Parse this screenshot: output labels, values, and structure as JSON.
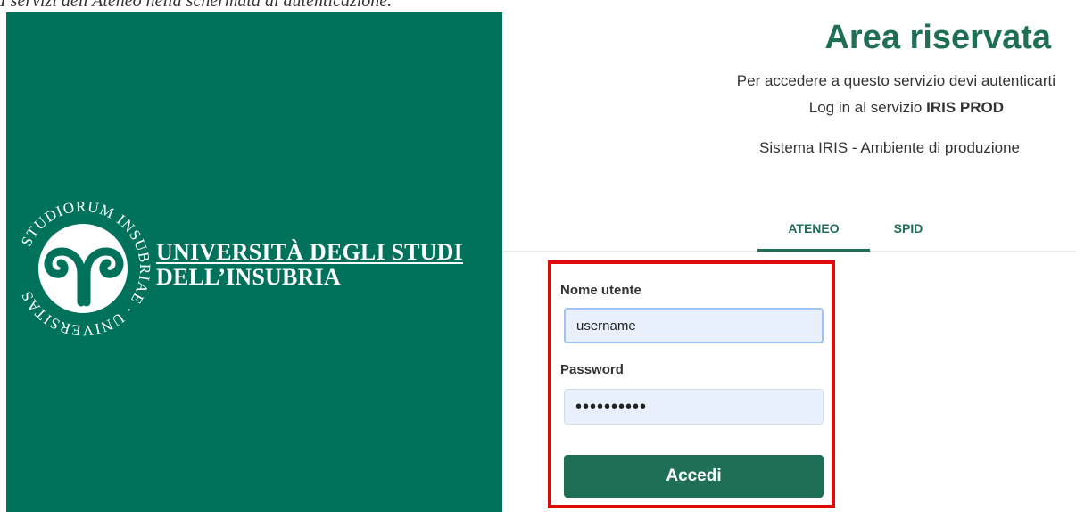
{
  "caption": "I servizi dell'Ateneo nella schermata di autenticazione.",
  "brand": {
    "name_line1": "UNIVERSITÀ DEGLI STUDI",
    "name_line2": "DELL’INSUBRIA",
    "seal_text": "STUDIORUM INSUBRIAE · UNIVERSITAS",
    "background_color": "#00715a",
    "accent_color": "#1e6f55"
  },
  "header": {
    "title": "Area riservata",
    "subtitle": "Per accedere a questo servizio devi autenticarti",
    "service_prefix": "Log in al servizio",
    "service_name": "IRIS PROD",
    "system": "Sistema IRIS - Ambiente di produzione"
  },
  "tabs": [
    {
      "label": "ATENEO",
      "active": true
    },
    {
      "label": "SPID",
      "active": false
    }
  ],
  "form": {
    "username_label": "Nome utente",
    "username_value": "username",
    "password_label": "Password",
    "password_value": "••••••••••",
    "submit_label": "Accedi",
    "highlight_color": "#e10a0a"
  }
}
